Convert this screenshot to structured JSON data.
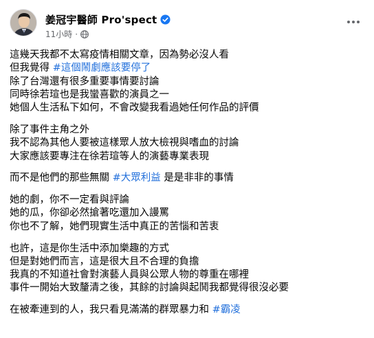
{
  "post": {
    "author": "姜冠宇醫師 Pro'spect",
    "time": "11小時",
    "dot": "·",
    "icons": {
      "verified": "verified-badge-icon",
      "privacy": "globe-icon",
      "menu": "more-options-icon",
      "verified_color": "#1877f2"
    },
    "hashtag_color": "#216fdb",
    "paragraphs": [
      {
        "lines": [
          {
            "segments": [
              {
                "text": "這幾天我都不太寫疫情相關文章，因為勢必沒人看"
              }
            ]
          },
          {
            "segments": [
              {
                "text": "但我覺得 "
              },
              {
                "text": "#這個鬧劇應該要停了",
                "tag": true
              }
            ]
          },
          {
            "segments": [
              {
                "text": "除了台灣還有很多重要事情要討論"
              }
            ]
          },
          {
            "segments": [
              {
                "text": "同時徐若瑄也是我蠻喜歡的演員之一"
              }
            ]
          },
          {
            "segments": [
              {
                "text": "她個人生活私下如何，不會改變我看過她任何作品的評價"
              }
            ]
          }
        ]
      },
      {
        "lines": [
          {
            "segments": [
              {
                "text": "除了事件主角之外"
              }
            ]
          },
          {
            "segments": [
              {
                "text": "我不認為其他人要被這樣眾人放大檢視與嗜血的討論"
              }
            ]
          },
          {
            "segments": [
              {
                "text": "大家應該要專注在徐若瑄等人的演藝專業表現"
              }
            ]
          }
        ]
      },
      {
        "lines": [
          {
            "segments": [
              {
                "text": "而不是他們的那些無關 "
              },
              {
                "text": "#大眾利益",
                "tag": true
              },
              {
                "text": " 是是非非的事情"
              }
            ]
          }
        ]
      },
      {
        "lines": [
          {
            "segments": [
              {
                "text": "她的劇，你不一定看與評論"
              }
            ]
          },
          {
            "segments": [
              {
                "text": "她的瓜，你卻必然搶著吃還加入謾罵"
              }
            ]
          },
          {
            "segments": [
              {
                "text": "你也不了解，她們現實生活中真正的苦惱和苦衷"
              }
            ]
          }
        ]
      },
      {
        "lines": [
          {
            "segments": [
              {
                "text": "也許，這是你生活中添加樂趣的方式"
              }
            ]
          },
          {
            "segments": [
              {
                "text": "但是對她們而言，這是很大且不合理的負擔"
              }
            ]
          },
          {
            "segments": [
              {
                "text": "我真的不知道社會對演藝人員與公眾人物的尊重在哪裡"
              }
            ]
          },
          {
            "segments": [
              {
                "text": "事件一開始大致釐清之後，其餘的討論與起鬨我都覺得很沒必要"
              }
            ]
          }
        ]
      },
      {
        "lines": [
          {
            "segments": [
              {
                "text": "在被牽連到的人，我只看見滿滿的群眾暴力和 "
              },
              {
                "text": "#霸凌",
                "tag": true
              }
            ]
          }
        ]
      }
    ]
  }
}
